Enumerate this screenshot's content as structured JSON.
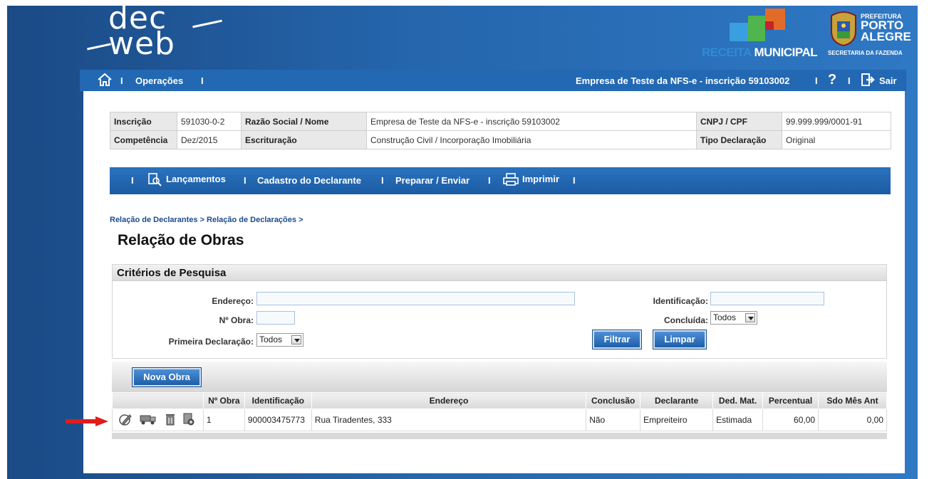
{
  "header": {
    "logo_line1": "dec",
    "logo_line2": "web",
    "receita_a": "RECEITA",
    "receita_b": "MUNICIPAL",
    "prefeitura": "PREFEITURA",
    "porto": "PORTO",
    "alegre": "ALEGRE",
    "secretaria": "SECRETARIA DA FAZENDA"
  },
  "topnav": {
    "operacoes": "Operações",
    "empresa": "Empresa de Teste da NFS-e - inscrição 59103002",
    "sair": "Sair",
    "separator": "I"
  },
  "info": {
    "inscricao_label": "Inscrição",
    "inscricao_value": "591030-0-2",
    "razao_label": "Razão Social / Nome",
    "razao_value": "Empresa de Teste da NFS-e - inscrição 59103002",
    "cnpj_label": "CNPJ / CPF",
    "cnpj_value": "99.999.999/0001-91",
    "competencia_label": "Competência",
    "competencia_value": "Dez/2015",
    "escrituracao_label": "Escrituração",
    "escrituracao_value": "Construção Civil / Incorporação Imobiliária",
    "tipo_label": "Tipo Declaração",
    "tipo_value": "Original"
  },
  "secnav": {
    "lancamentos": "Lançamentos",
    "cadastro": "Cadastro do Declarante",
    "preparar": "Preparar / Enviar",
    "imprimir": "Imprimir"
  },
  "breadcrumb": "Relação de Declarantes > Relação de Declarações >",
  "page_title": "Relação de Obras",
  "criteria": {
    "title": "Critérios de Pesquisa",
    "endereco_label": "Endereço:",
    "endereco_value": "",
    "nobra_label": "Nº Obra:",
    "nobra_value": "",
    "primeira_label": "Primeira Declaração:",
    "primeira_value": "Todos",
    "identificacao_label": "Identificação:",
    "identificacao_value": "",
    "concluida_label": "Concluída:",
    "concluida_value": "Todos",
    "filtrar": "Filtrar",
    "limpar": "Limpar"
  },
  "results": {
    "nova_obra": "Nova Obra",
    "columns": [
      "",
      "Nº Obra",
      "Identificação",
      "Endereço",
      "Conclusão",
      "Declarante",
      "Ded. Mat.",
      "Percentual",
      "Sdo Mês Ant"
    ],
    "rows": [
      {
        "nobra": "1",
        "identificacao": "900003475773",
        "endereco": "Rua Tiradentes, 333",
        "conclusao": "Não",
        "declarante": "Empreiteiro",
        "ded_mat": "Estimada",
        "percentual": "60,00",
        "sdo_mes_ant": "0,00"
      }
    ]
  },
  "icons": {
    "home": "home-icon",
    "help": "help-icon",
    "logout": "logout-icon",
    "search_doc": "search-document-icon",
    "printer": "printer-icon",
    "edit": "edit-icon",
    "truck": "truck-icon",
    "trash": "trash-icon",
    "doc": "document-icon"
  },
  "colors": {
    "header_blue": "#2566ad",
    "nav_blue": "#2368b2",
    "arrow_red": "#e21b1b"
  }
}
